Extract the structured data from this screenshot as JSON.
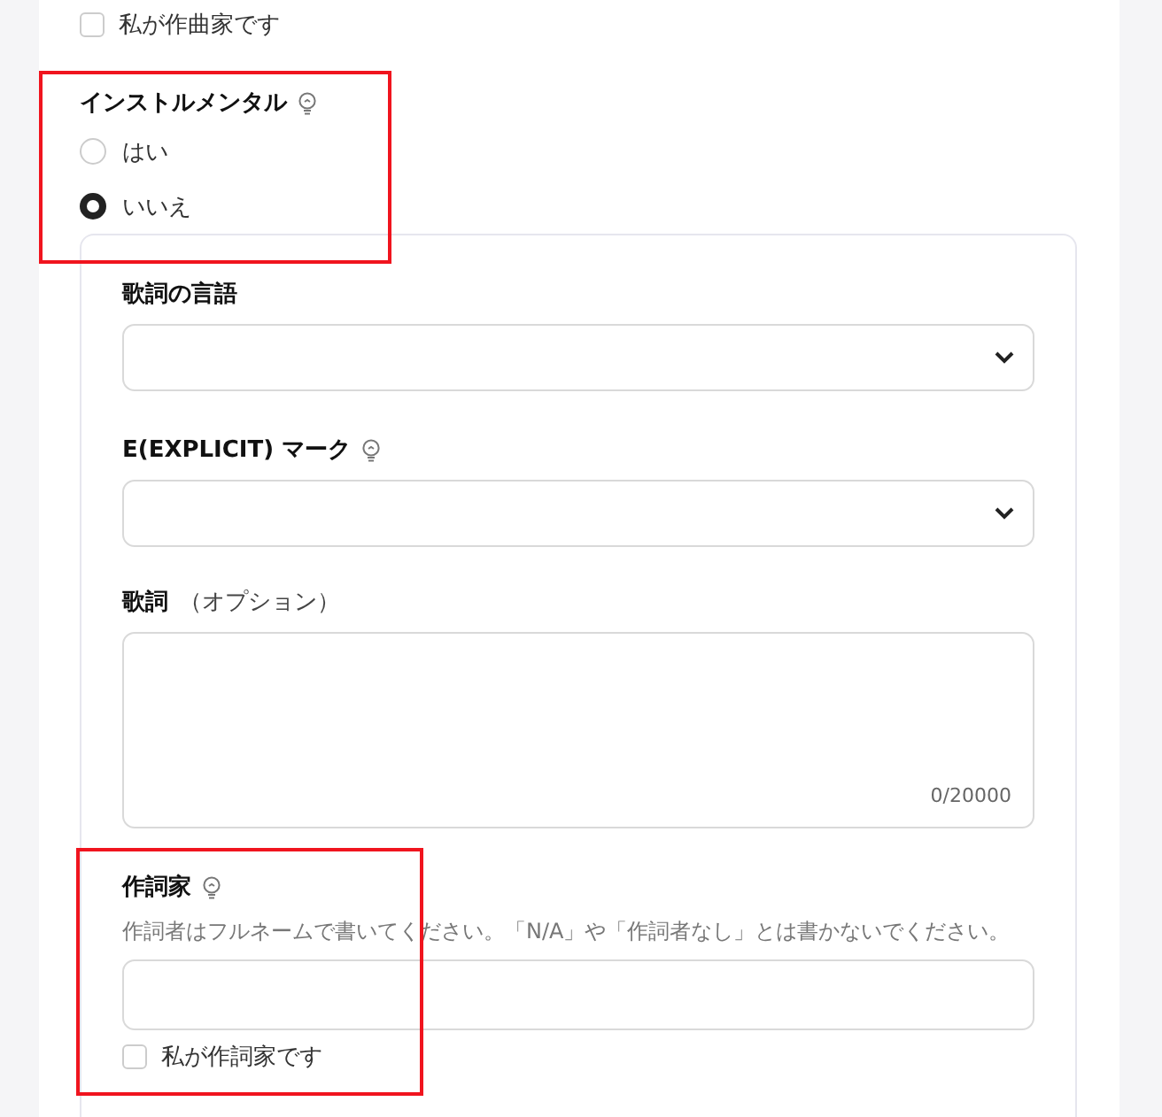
{
  "composer_checkbox": {
    "label": "私が作曲家です",
    "checked": false
  },
  "instrumental": {
    "label": "インストルメンタル",
    "options": [
      {
        "label": "はい",
        "selected": false
      },
      {
        "label": "いいえ",
        "selected": true
      }
    ]
  },
  "lyrics_language": {
    "label": "歌詞の言語"
  },
  "explicit": {
    "label": "E(EXPLICIT) マーク"
  },
  "lyrics": {
    "label": "歌詞",
    "optional": "（オプション）",
    "counter": "0/20000"
  },
  "lyricist": {
    "label": "作詞家",
    "help": "作詞者はフルネームで書いてください。「N/A」や「作詞者なし」とは書かないでください。",
    "checkbox": {
      "label": "私が作詞家です",
      "checked": false
    }
  }
}
